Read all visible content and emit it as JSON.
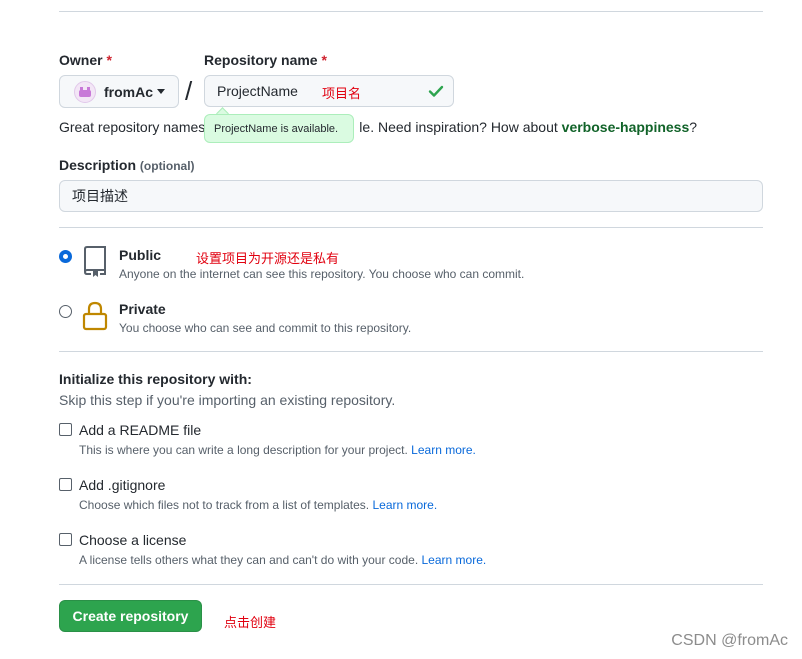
{
  "owner": {
    "label": "Owner",
    "required_mark": "*",
    "name": "fromAc"
  },
  "repo_name": {
    "label": "Repository name",
    "required_mark": "*",
    "value": "ProjectName",
    "annotation": "项目名",
    "tooltip": "ProjectName is available."
  },
  "hint": {
    "prefix": "Great repository names",
    "suffix": "le. Need inspiration? How about",
    "suggestion": "verbose-happiness",
    "end": "?"
  },
  "description": {
    "label": "Description",
    "optional": "(optional)",
    "value": "项目描述"
  },
  "visibility": {
    "annotation": "设置项目为开源还是私有",
    "public": {
      "title": "Public",
      "desc": "Anyone on the internet can see this repository. You choose who can commit.",
      "selected": true
    },
    "private": {
      "title": "Private",
      "desc": "You choose who can see and commit to this repository.",
      "selected": false
    }
  },
  "init": {
    "title": "Initialize this repository with:",
    "subtitle": "Skip this step if you're importing an existing repository.",
    "options": [
      {
        "title": "Add a README file",
        "desc": "This is where you can write a long description for your project.",
        "link": "Learn more.",
        "checked": false
      },
      {
        "title": "Add .gitignore",
        "desc": "Choose which files not to track from a list of templates.",
        "link": "Learn more.",
        "checked": false
      },
      {
        "title": "Choose a license",
        "desc": "A license tells others what they can and can't do with your code.",
        "link": "Learn more.",
        "checked": false
      }
    ]
  },
  "create": {
    "label": "Create repository",
    "annotation": "点击创建"
  },
  "watermark": "CSDN @fromAc",
  "colors": {
    "accent": "#0969da",
    "success": "#2da44e",
    "annotation": "#e1000f",
    "lock": "#bf8700"
  }
}
